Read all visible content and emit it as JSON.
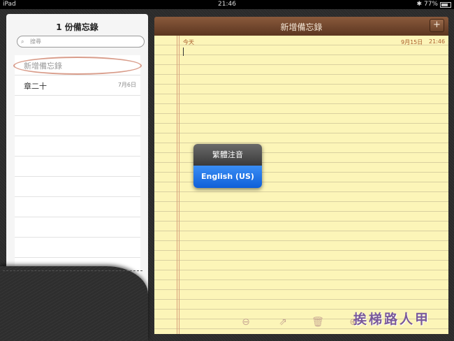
{
  "status_bar": {
    "device": "iPad",
    "time": "21:46",
    "battery": "77%",
    "battery_level": 0.77
  },
  "sidebar": {
    "title": "1 份備忘錄",
    "search_placeholder": "搜尋",
    "notes": [
      {
        "title": "新增備忘錄",
        "date": ""
      },
      {
        "title": "章二十",
        "date": "7月6日"
      }
    ]
  },
  "note": {
    "header_title": "新增備忘錄",
    "add_label": "+",
    "today_label": "今天",
    "date": "9月15日",
    "time": "21:46"
  },
  "keyboard_popup": {
    "options": [
      "繁體注音",
      "English (US)"
    ],
    "selected": "English (US)"
  },
  "toolbar": {
    "icons": [
      "back-arrow-icon",
      "share-icon",
      "trash-icon",
      "forward-arrow-icon"
    ]
  },
  "watermark": "挨梯路人甲"
}
